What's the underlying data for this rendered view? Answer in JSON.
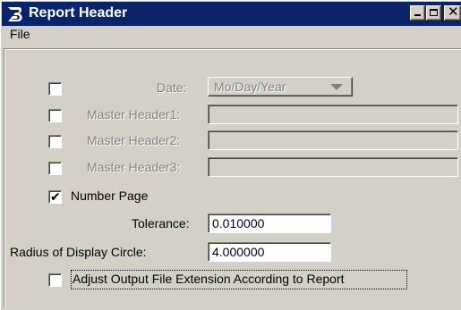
{
  "window": {
    "title": "Report Header",
    "icon": "bentley-b-icon",
    "controls": [
      "minimize",
      "maximize",
      "close"
    ]
  },
  "menu": {
    "file": "File"
  },
  "form": {
    "date": {
      "checked": false,
      "label": "Date:",
      "value": "Mo/Day/Year"
    },
    "master_header1": {
      "checked": false,
      "label": "Master Header1:",
      "value": ""
    },
    "master_header2": {
      "checked": false,
      "label": "Master Header2:",
      "value": ""
    },
    "master_header3": {
      "checked": false,
      "label": "Master Header3:",
      "value": ""
    },
    "number_page": {
      "checked": true,
      "label": "Number Page"
    },
    "tolerance": {
      "label": "Tolerance:",
      "value": "0.010000"
    },
    "radius": {
      "label": "Radius of Display Circle:",
      "value": "4.000000"
    },
    "adjust_extension": {
      "checked": false,
      "label": "Adjust Output File Extension According to Report"
    }
  },
  "colors": {
    "titlebar": "#0a246a",
    "face": "#d4d0c8",
    "disabled_text": "#808080"
  }
}
